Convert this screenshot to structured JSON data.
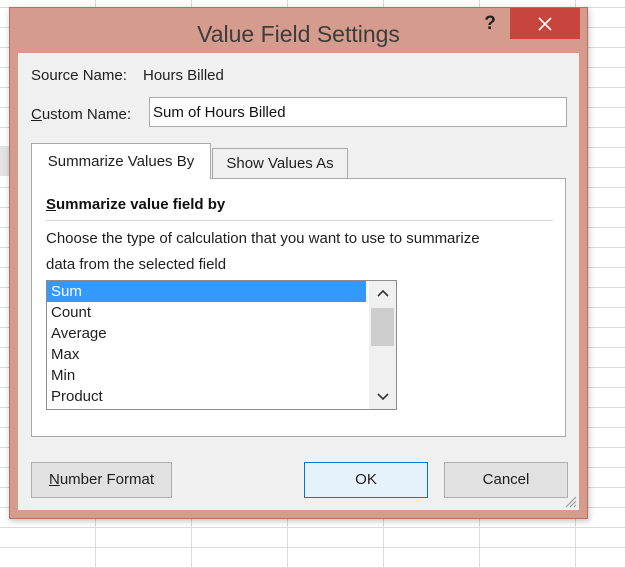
{
  "dialog": {
    "title": "Value Field Settings",
    "help_label": "?",
    "source_name_label": "Source Name:",
    "source_name_value": "Hours Billed",
    "custom_name_label": "Custom Name:",
    "custom_name_value": "Sum of Hours Billed"
  },
  "tabs": [
    {
      "label": "Summarize Values By",
      "active": true
    },
    {
      "label": "Show Values As",
      "active": false
    }
  ],
  "summarize": {
    "section_title": "Summarize value field by",
    "description_line1": "Choose the type of calculation that you want to use to summarize",
    "description_line2": "data from the selected field",
    "items": [
      "Sum",
      "Count",
      "Average",
      "Max",
      "Min",
      "Product"
    ],
    "selected": "Sum"
  },
  "buttons": {
    "number_format": "Number Format",
    "ok": "OK",
    "cancel": "Cancel"
  },
  "colors": {
    "frame": "#d59c8d",
    "close": "#c7453d",
    "selection": "#3399ff"
  },
  "icons": {
    "close": "close-icon",
    "scroll_up": "chevron-up-icon",
    "scroll_down": "chevron-down-icon",
    "resize": "resize-grip-icon"
  }
}
